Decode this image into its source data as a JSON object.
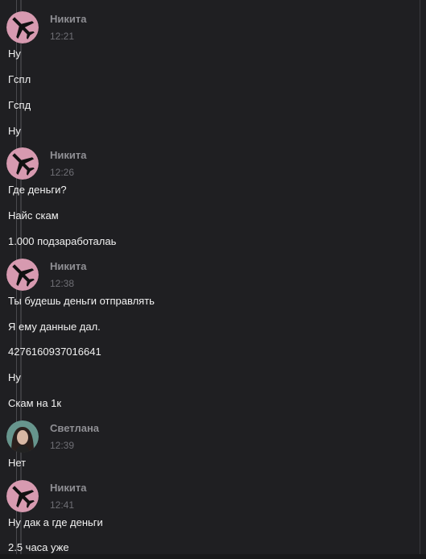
{
  "colors": {
    "background": "#1f1f22",
    "username": "#8f8f94",
    "timestamp": "#6f6f75",
    "message_text": "#f2f2f2",
    "avatar_pink": "#d79ab0"
  },
  "groups": [
    {
      "author": "Никита",
      "time": "12:21",
      "avatar": "airplane-icon",
      "lines": [
        "Ну",
        "Гспл",
        "Гспд",
        "Ну"
      ]
    },
    {
      "author": "Никита",
      "time": "12:26",
      "avatar": "airplane-icon",
      "lines": [
        "Где деньги?",
        "Найс скам",
        "1.000 подзаработалаь"
      ]
    },
    {
      "author": "Никита",
      "time": "12:38",
      "avatar": "airplane-icon",
      "lines": [
        "Ты будешь деньги отправлять",
        "Я ему данные дал.",
        "4276160937016641",
        "Ну",
        "Скам на 1к"
      ]
    },
    {
      "author": "Светлана",
      "time": "12:39",
      "avatar": "user-photo-avatar",
      "lines": [
        "Нет"
      ]
    },
    {
      "author": "Никита",
      "time": "12:41",
      "avatar": "airplane-icon",
      "lines": [
        "Ну дак а где деньги",
        "2.5 часа уже"
      ]
    }
  ]
}
